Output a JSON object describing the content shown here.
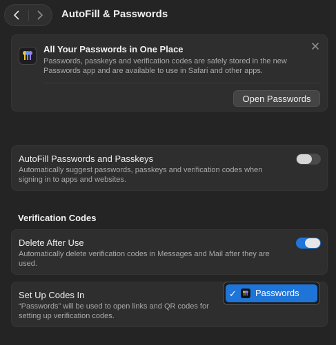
{
  "header": {
    "title": "AutoFill & Passwords"
  },
  "promo": {
    "heading": "All Your Passwords in One Place",
    "description": "Passwords, passkeys and verification codes are safely stored in the new Passwords app and are available to use in Safari and other apps.",
    "open_button": "Open Passwords"
  },
  "autofill": {
    "title": "AutoFill Passwords and Passkeys",
    "description": "Automatically suggest passwords, passkeys and verification codes when signing in to apps and websites.",
    "enabled": false
  },
  "verification": {
    "section_title": "Verification Codes",
    "delete_after_use": {
      "title": "Delete After Use",
      "description": "Automatically delete verification codes in Messages and Mail after they are used.",
      "enabled": true
    },
    "setup_codes": {
      "title": "Set Up Codes In",
      "description": "“Passwords” will be used to open links and QR codes for setting up verification codes.",
      "selected": "Passwords"
    }
  },
  "colors": {
    "accent": "#1f75d9",
    "background": "#242424",
    "card": "#2e2e2e"
  },
  "icons": [
    "chevron-left-icon",
    "chevron-right-icon",
    "passwords-app-icon",
    "close-icon",
    "checkmark-icon"
  ]
}
